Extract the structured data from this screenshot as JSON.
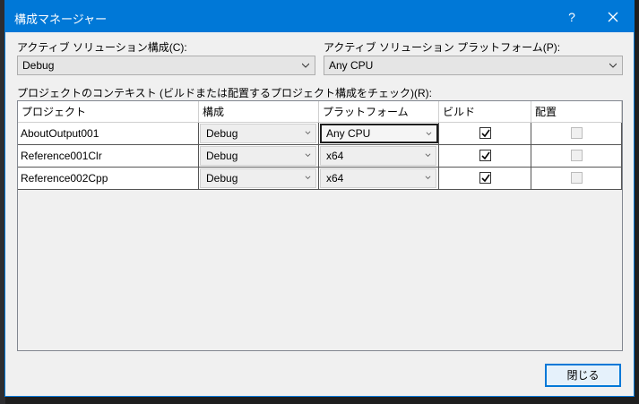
{
  "dialog": {
    "title": "構成マネージャー",
    "help": "?",
    "close_label": "閉じる"
  },
  "active_config": {
    "label": "アクティブ ソリューション構成(C):",
    "value": "Debug"
  },
  "active_platform": {
    "label": "アクティブ ソリューション プラットフォーム(P):",
    "value": "Any CPU"
  },
  "context_label": "プロジェクトのコンテキスト (ビルドまたは配置するプロジェクト構成をチェック)(R):",
  "grid": {
    "headers": [
      "プロジェクト",
      "構成",
      "プラットフォーム",
      "ビルド",
      "配置"
    ],
    "rows": [
      {
        "project": "AboutOutput001",
        "config": "Debug",
        "platform": "Any CPU",
        "build": true,
        "deploy": false
      },
      {
        "project": "Reference001Clr",
        "config": "Debug",
        "platform": "x64",
        "build": true,
        "deploy": false
      },
      {
        "project": "Reference002Cpp",
        "config": "Debug",
        "platform": "x64",
        "build": true,
        "deploy": false
      }
    ]
  },
  "colors": {
    "accent": "#0078d7",
    "dialog_bg": "#f0f0f0",
    "ide_bg": "#1e1e1e"
  }
}
